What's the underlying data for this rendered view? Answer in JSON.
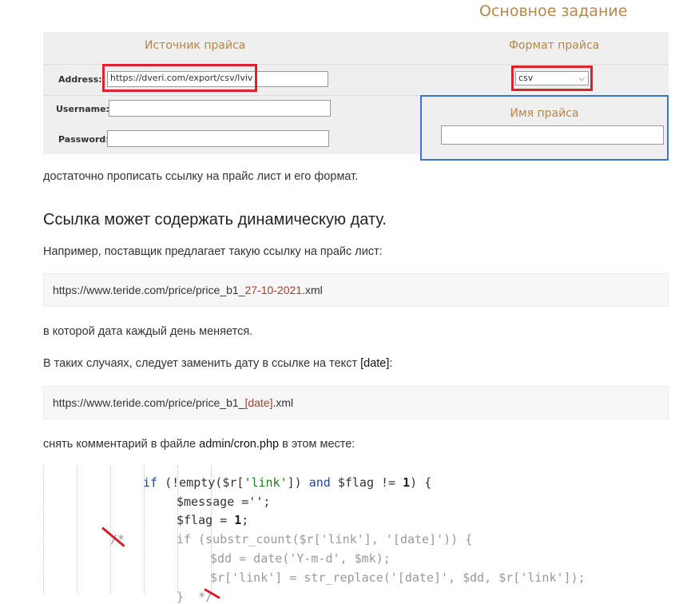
{
  "section_title": "Основное задание",
  "form": {
    "source_header": "Источник прайса",
    "format_header": "Формат прайса",
    "address_label": "Address:",
    "address_value": "https://dveri.com/export/csv/lviv",
    "username_label": "Username:",
    "password_label": "Password:",
    "format_value": "csv",
    "price_name_label": "Имя прайса"
  },
  "text": {
    "p1": "достаточно прописать ссылку на прайс лист и его формат.",
    "h2": "Ссылка может содержать динамическую дату.",
    "p2": "Например, поставщик предлагает такую ссылку на прайс лист:",
    "url1_prefix": "https://www.teride.com/price/price_b1_",
    "url1_date": "27-10-2021",
    "url1_suffix": ".xml",
    "p3": "в которой дата каждый день меняется.",
    "p4_prefix": "В таких случаях, следует заменить дату в ссылке на текст ",
    "p4_token": "[date]",
    "p4_suffix": ":",
    "url2_prefix": "https://www.teride.com/price/price_b1_",
    "url2_date": "[date]",
    "url2_suffix": ".xml",
    "p5_prefix": "снять комментарий в файле ",
    "p5_file": "admin/cron.php",
    "p5_suffix": " в этом месте:"
  },
  "code": {
    "l1_if": "if",
    "l1_a": " (!empty($r[",
    "l1_link": "'link'",
    "l1_b": "]) ",
    "l1_and": "and",
    "l1_c": " $flag != ",
    "l1_num": "1",
    "l1_d": ") {",
    "l2": "$message ='';",
    "l3_a": "$flag = ",
    "l3_num": "1",
    "l3_b": ";",
    "l4_cm": "/*",
    "l4": "if (substr_count($r['link'], '[date]')) {",
    "l5": "$dd = date('Y-m-d', $mk);",
    "l6": "$r['link'] = str_replace('[date]', $dd, $r['link']);",
    "l7": "}  */"
  },
  "colors": {
    "accent": "#b7864b",
    "highlight_red": "#e0202c",
    "highlight_blue": "#3a72d6",
    "date_text": "#a0412b"
  }
}
